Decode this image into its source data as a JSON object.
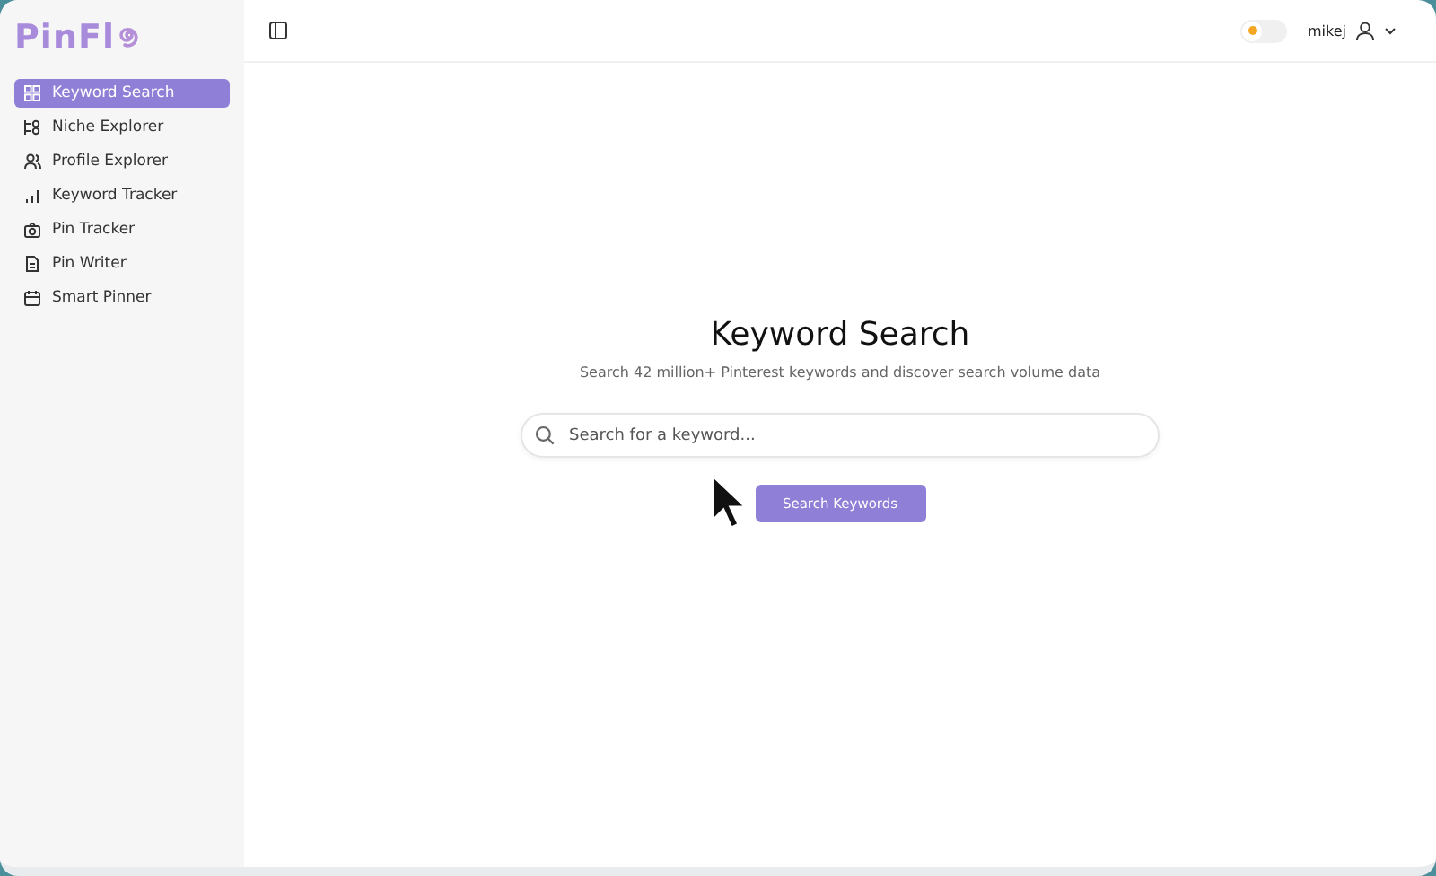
{
  "logo": {
    "text": "PinFl"
  },
  "sidebar": {
    "items": [
      {
        "label": "Keyword Search",
        "selected": true
      },
      {
        "label": "Niche Explorer",
        "selected": false
      },
      {
        "label": "Profile Explorer",
        "selected": false
      },
      {
        "label": "Keyword Tracker",
        "selected": false
      },
      {
        "label": "Pin Tracker",
        "selected": false
      },
      {
        "label": "Pin Writer",
        "selected": false
      },
      {
        "label": "Smart Pinner",
        "selected": false
      }
    ]
  },
  "topbar": {
    "theme_dark": false,
    "username": "mikej"
  },
  "main": {
    "title": "Keyword Search",
    "subtitle": "Search 42 million+ Pinterest keywords and discover search volume data",
    "search": {
      "placeholder": "Search for a keyword..."
    },
    "button": "Search Keywords"
  }
}
